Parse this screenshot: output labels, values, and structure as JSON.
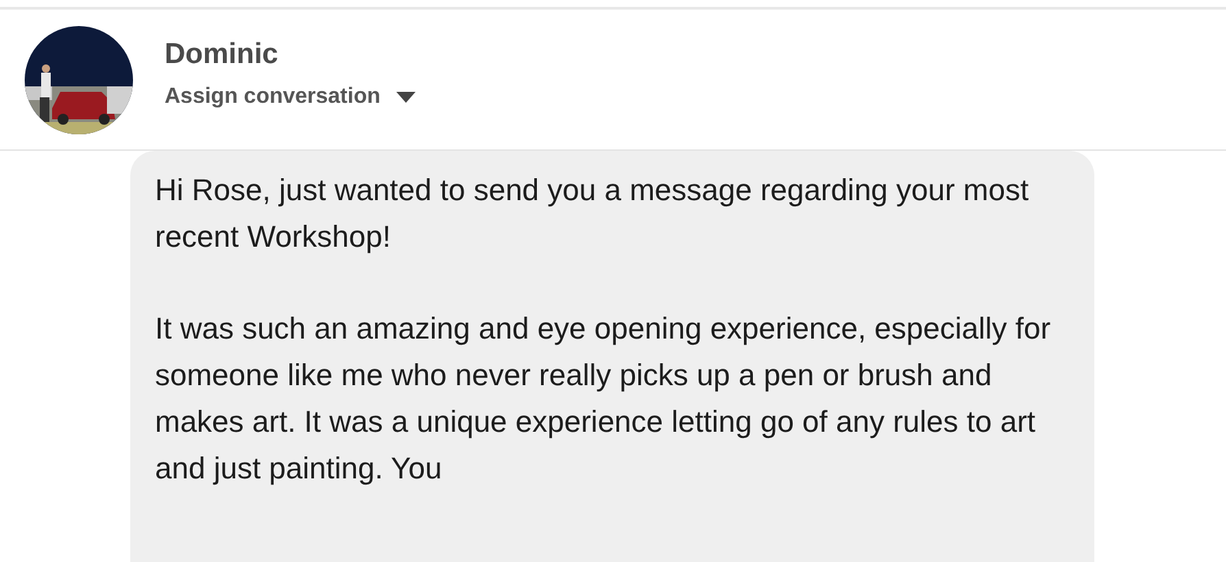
{
  "contact": {
    "name": "Dominic",
    "assign_label": "Assign conversation"
  },
  "message": {
    "paragraphs": [
      "Hi Rose, just wanted to send you a message regarding your most recent Workshop!",
      "It was such an amazing and eye opening experience, especially for someone like me who never really picks up a pen or brush and makes art. It was a unique experience letting go of any rules to art and just painting. You"
    ]
  }
}
